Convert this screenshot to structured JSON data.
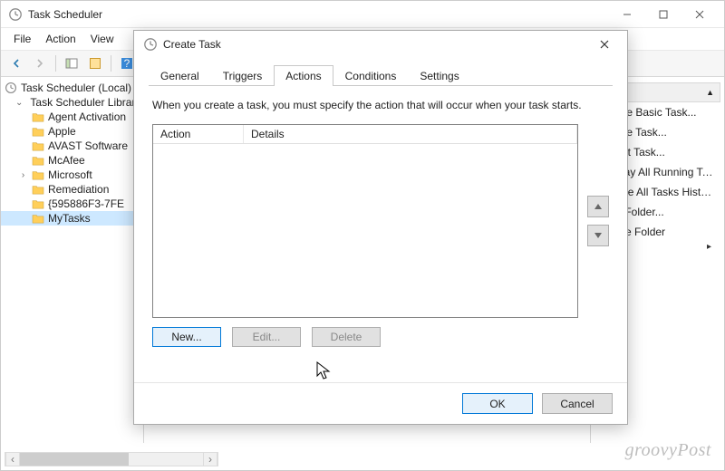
{
  "main_window": {
    "title": "Task Scheduler",
    "menus": [
      "File",
      "Action",
      "View"
    ],
    "tree": {
      "root": "Task Scheduler (Local)",
      "lib": "Task Scheduler Library",
      "items": [
        "Agent Activation",
        "Apple",
        "AVAST Software",
        "McAfee",
        "Microsoft",
        "Remediation",
        "{595886F3-7FE",
        "MyTasks"
      ]
    },
    "right_pane": {
      "items": [
        "Create Basic Task...",
        "Create Task...",
        "Import Task...",
        "Display All Running Tasks",
        "Enable All Tasks History",
        "New Folder...",
        "Delete Folder"
      ]
    }
  },
  "dialog": {
    "title": "Create Task",
    "tabs": [
      "General",
      "Triggers",
      "Actions",
      "Conditions",
      "Settings"
    ],
    "active_tab": "Actions",
    "description": "When you create a task, you must specify the action that will occur when your task starts.",
    "columns": {
      "action": "Action",
      "details": "Details"
    },
    "buttons": {
      "new": "New...",
      "edit": "Edit...",
      "delete": "Delete",
      "ok": "OK",
      "cancel": "Cancel"
    }
  },
  "watermark": "groovyPost"
}
